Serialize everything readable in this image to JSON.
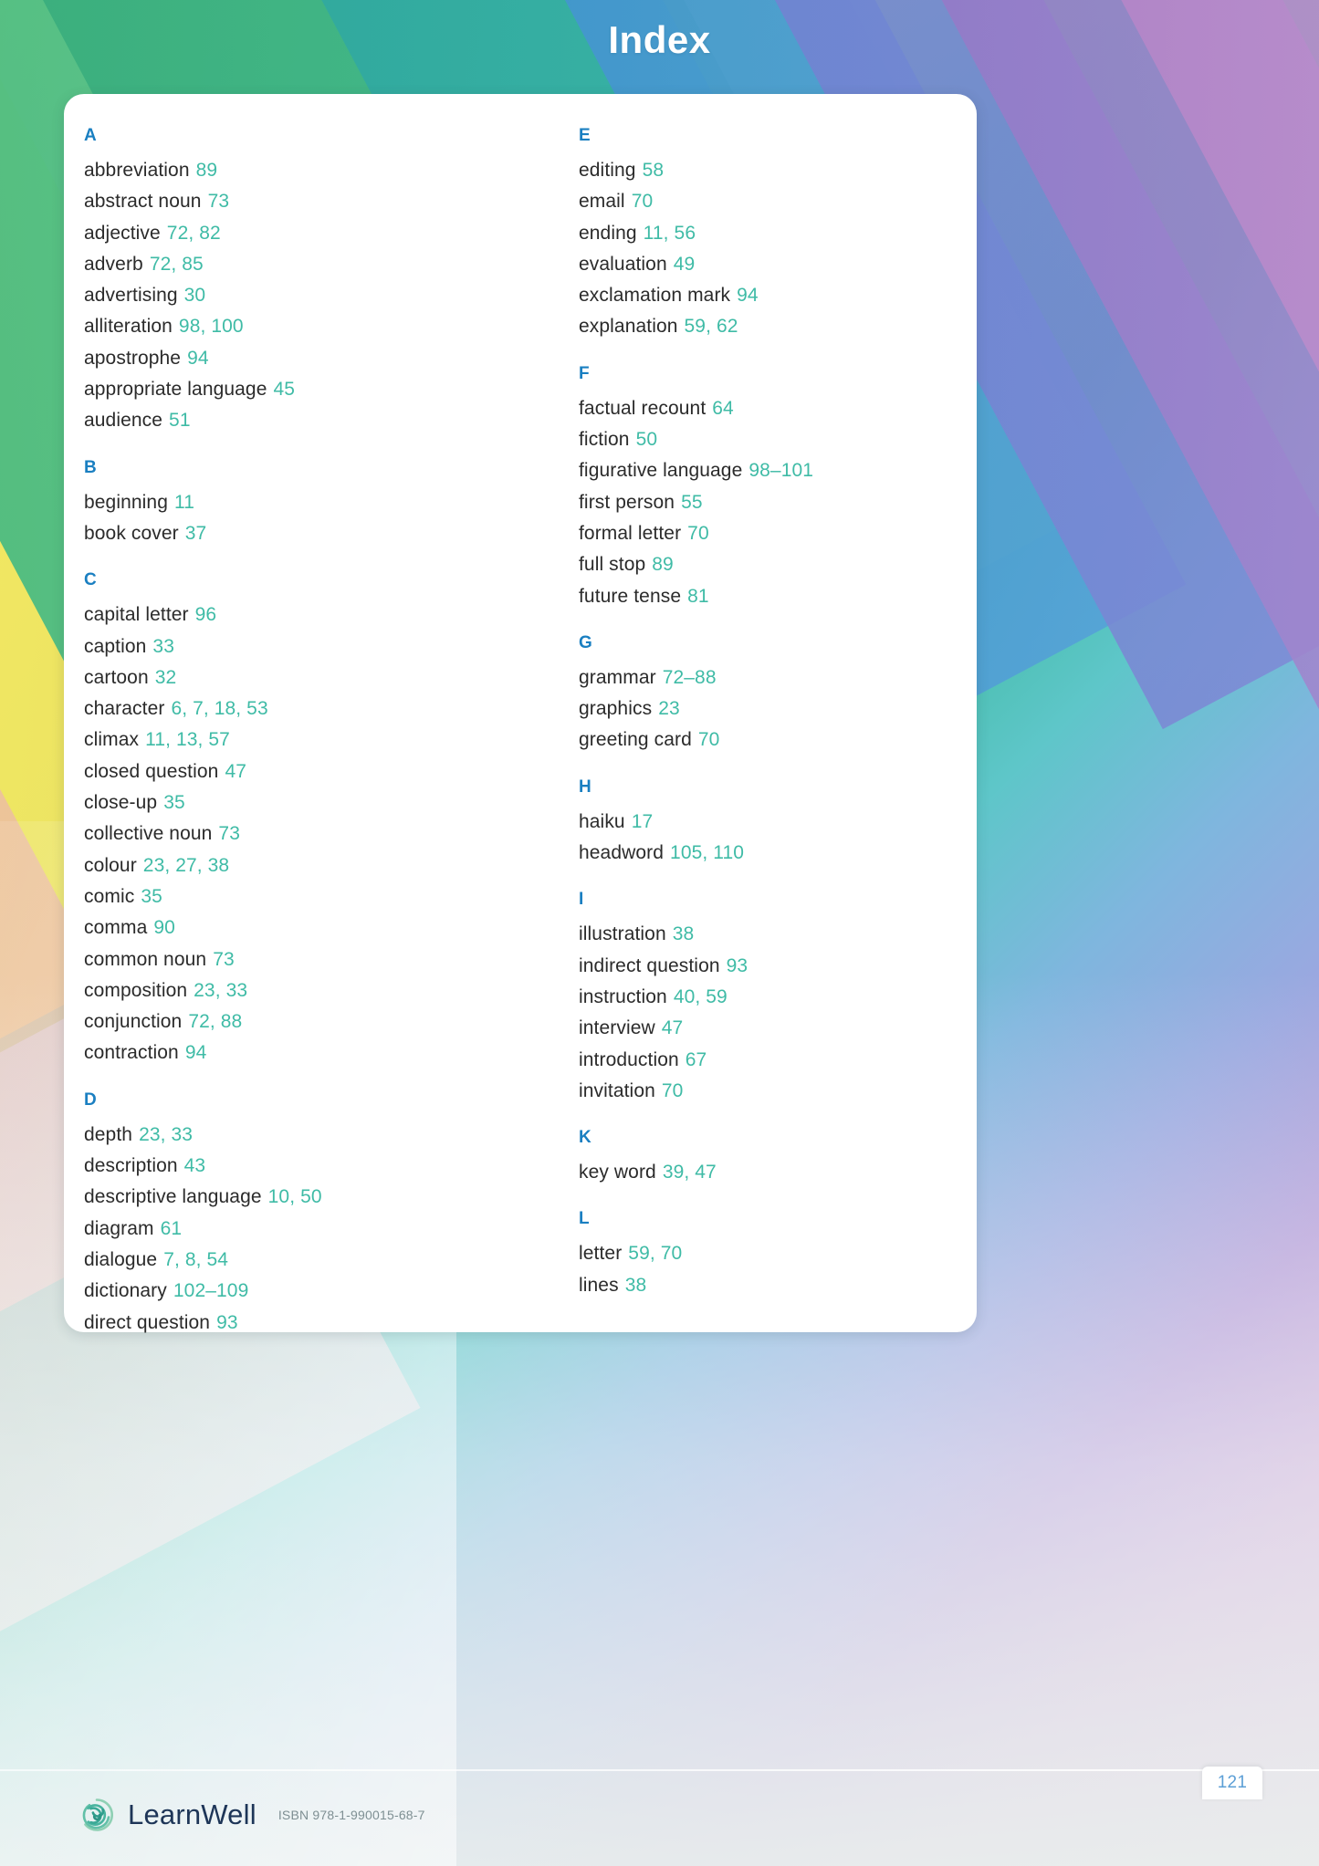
{
  "header": {
    "title": "Index"
  },
  "colors": {
    "letter_heading": "#1a7fc1",
    "entry_term": "#2b2b2b",
    "page_numbers": "#3fbba6",
    "brand_text": "#1d3557",
    "page_number_text": "#5c9fd6"
  },
  "index": {
    "left_column": [
      {
        "letter": "A",
        "entries": [
          {
            "term": "abbreviation",
            "pages": "89"
          },
          {
            "term": "abstract noun",
            "pages": "73"
          },
          {
            "term": "adjective",
            "pages": "72, 82"
          },
          {
            "term": "adverb",
            "pages": "72, 85"
          },
          {
            "term": "advertising",
            "pages": "30"
          },
          {
            "term": "alliteration",
            "pages": "98, 100"
          },
          {
            "term": "apostrophe",
            "pages": "94"
          },
          {
            "term": "appropriate language",
            "pages": "45"
          },
          {
            "term": "audience",
            "pages": "51"
          }
        ]
      },
      {
        "letter": "B",
        "entries": [
          {
            "term": "beginning",
            "pages": "11"
          },
          {
            "term": "book cover",
            "pages": "37"
          }
        ]
      },
      {
        "letter": "C",
        "entries": [
          {
            "term": "capital letter",
            "pages": "96"
          },
          {
            "term": "caption",
            "pages": "33"
          },
          {
            "term": "cartoon",
            "pages": "32"
          },
          {
            "term": "character",
            "pages": "6, 7, 18, 53"
          },
          {
            "term": "climax",
            "pages": "11, 13, 57"
          },
          {
            "term": "closed question",
            "pages": "47"
          },
          {
            "term": "close-up",
            "pages": "35"
          },
          {
            "term": "collective noun",
            "pages": "73"
          },
          {
            "term": "colour",
            "pages": "23, 27, 38"
          },
          {
            "term": "comic",
            "pages": "35"
          },
          {
            "term": "comma",
            "pages": "90"
          },
          {
            "term": "common noun",
            "pages": "73"
          },
          {
            "term": "composition",
            "pages": "23, 33"
          },
          {
            "term": "conjunction",
            "pages": "72, 88"
          },
          {
            "term": "contraction",
            "pages": "94"
          }
        ]
      },
      {
        "letter": "D",
        "entries": [
          {
            "term": "depth",
            "pages": "23, 33"
          },
          {
            "term": "description",
            "pages": "43"
          },
          {
            "term": "descriptive language",
            "pages": "10, 50"
          },
          {
            "term": "diagram",
            "pages": "61"
          },
          {
            "term": "dialogue",
            "pages": "7, 8, 54"
          },
          {
            "term": "dictionary",
            "pages": "102–109"
          },
          {
            "term": "direct question",
            "pages": "93"
          }
        ]
      }
    ],
    "right_column": [
      {
        "letter": "E",
        "entries": [
          {
            "term": "editing",
            "pages": "58"
          },
          {
            "term": "email",
            "pages": "70"
          },
          {
            "term": "ending",
            "pages": "11, 56"
          },
          {
            "term": "evaluation",
            "pages": "49"
          },
          {
            "term": "exclamation mark",
            "pages": "94"
          },
          {
            "term": "explanation",
            "pages": "59, 62"
          }
        ]
      },
      {
        "letter": "F",
        "entries": [
          {
            "term": "factual recount",
            "pages": "64"
          },
          {
            "term": "fiction",
            "pages": "50"
          },
          {
            "term": "figurative language",
            "pages": "98–101"
          },
          {
            "term": "first person",
            "pages": "55"
          },
          {
            "term": "formal letter",
            "pages": "70"
          },
          {
            "term": "full stop",
            "pages": "89"
          },
          {
            "term": "future tense",
            "pages": "81"
          }
        ]
      },
      {
        "letter": "G",
        "entries": [
          {
            "term": "grammar",
            "pages": "72–88"
          },
          {
            "term": "graphics",
            "pages": "23"
          },
          {
            "term": "greeting card",
            "pages": "70"
          }
        ]
      },
      {
        "letter": "H",
        "entries": [
          {
            "term": "haiku",
            "pages": "17"
          },
          {
            "term": "headword",
            "pages": "105, 110"
          }
        ]
      },
      {
        "letter": "I",
        "entries": [
          {
            "term": "illustration",
            "pages": "38"
          },
          {
            "term": "indirect question",
            "pages": "93"
          },
          {
            "term": "instruction",
            "pages": "40, 59"
          },
          {
            "term": "interview",
            "pages": "47"
          },
          {
            "term": "introduction",
            "pages": "67"
          },
          {
            "term": "invitation",
            "pages": "70"
          }
        ]
      },
      {
        "letter": "K",
        "entries": [
          {
            "term": "key word",
            "pages": "39, 47"
          }
        ]
      },
      {
        "letter": "L",
        "entries": [
          {
            "term": "letter",
            "pages": "59, 70"
          },
          {
            "term": "lines",
            "pages": "38"
          }
        ]
      }
    ]
  },
  "footer": {
    "brand_name": "LearnWell",
    "isbn": "ISBN 978-1-990015-68-7",
    "page_number": "121"
  }
}
